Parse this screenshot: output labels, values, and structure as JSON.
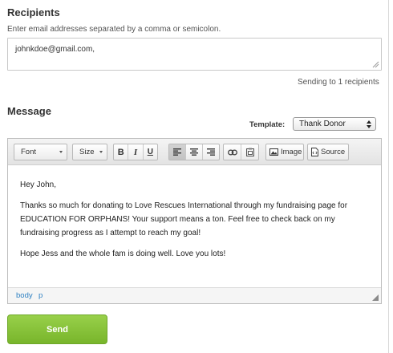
{
  "recipients": {
    "title": "Recipients",
    "hint": "Enter email addresses separated by a comma or semicolon.",
    "value": "johnkdoe@gmail.com,",
    "sending_text": "Sending to 1 recipients"
  },
  "message": {
    "title": "Message",
    "template_label": "Template:",
    "template_selected": "Thank Donor"
  },
  "toolbar": {
    "font_label": "Font",
    "size_label": "Size",
    "bold": "B",
    "italic": "I",
    "underline": "U",
    "image_label": "Image",
    "source_label": "Source"
  },
  "editor": {
    "greeting": "Hey John,",
    "paragraph1_line1": "Thanks so much for donating to Love Rescues International through my fundraising page for",
    "paragraph1_line2": "EDUCATION FOR ORPHANS! Your support means a ton. Feel free to check back on my",
    "paragraph1_line3": "fundraising progress as I attempt to reach my goal!",
    "paragraph2": "Hope Jess and the whole fam is doing well. Love you lots!",
    "path_body": "body",
    "path_p": "p"
  },
  "send_label": "Send"
}
